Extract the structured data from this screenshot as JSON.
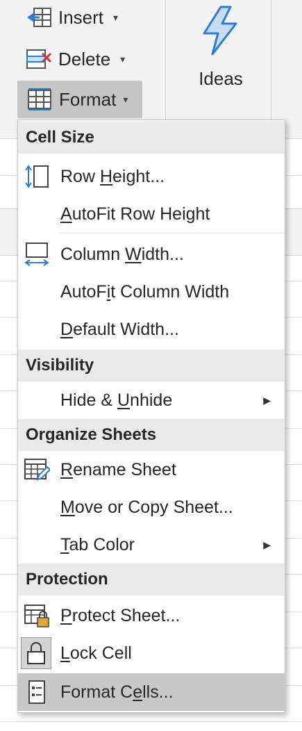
{
  "ribbon": {
    "insert": {
      "label": "Insert",
      "icon": "insert-cells-icon"
    },
    "delete": {
      "label": "Delete",
      "icon": "delete-cells-icon"
    },
    "format": {
      "label": "Format",
      "icon": "format-cells-icon"
    },
    "ideas": {
      "label": "Ideas",
      "icon": "lightning-bolt-icon"
    }
  },
  "menu": {
    "sections": {
      "cell_size": "Cell Size",
      "visibility": "Visibility",
      "organize": "Organize Sheets",
      "protection": "Protection"
    },
    "items": {
      "row_height": {
        "pre": "Row ",
        "key": "H",
        "post": "eight..."
      },
      "autofit_row": {
        "pre": "",
        "key": "A",
        "post": "utoFit Row Height"
      },
      "column_width": {
        "pre": "Column ",
        "key": "W",
        "post": "idth..."
      },
      "autofit_column": {
        "pre": "AutoF",
        "key": "i",
        "post": "t Column Width"
      },
      "default_width": {
        "pre": "",
        "key": "D",
        "post": "efault Width..."
      },
      "hide_unhide": {
        "pre": "Hide & ",
        "key": "U",
        "post": "nhide"
      },
      "rename_sheet": {
        "pre": "",
        "key": "R",
        "post": "ename Sheet"
      },
      "move_copy": {
        "pre": "",
        "key": "M",
        "post": "ove or Copy Sheet..."
      },
      "tab_color": {
        "pre": "",
        "key": "T",
        "post": "ab Color"
      },
      "protect_sheet": {
        "pre": "",
        "key": "P",
        "post": "rotect Sheet..."
      },
      "lock_cell": {
        "pre": "",
        "key": "L",
        "post": "ock Cell"
      },
      "format_cells": {
        "pre": "Format C",
        "key": "e",
        "post": "lls..."
      }
    }
  },
  "colors": {
    "accent_blue": "#2b7cd3",
    "delete_red": "#d13438",
    "lock_orange": "#e8a33d",
    "highlight": "#c8c8c8"
  }
}
